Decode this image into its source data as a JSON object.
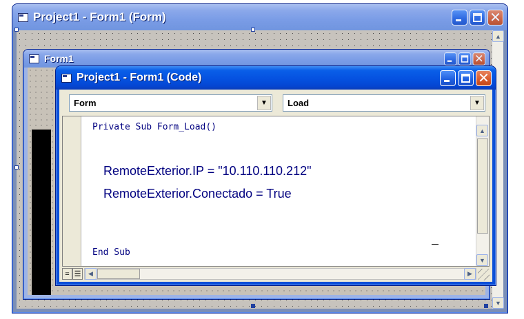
{
  "designer_window": {
    "title": "Project1 - Form1 (Form)",
    "icon": "form-designer-icon",
    "state": "inactive"
  },
  "form1_window": {
    "title": "Form1",
    "icon": "form-icon",
    "state": "inactive"
  },
  "code_window": {
    "title": "Project1 - Form1 (Code)",
    "icon": "code-window-icon",
    "state": "active",
    "object_combo": {
      "value": "Form"
    },
    "procedure_combo": {
      "value": "Load"
    },
    "code_lines": {
      "sub_start": "Private Sub Form_Load()",
      "ip_assign": "RemoteExterior.IP = \"10.110.110.212\"",
      "connect_assign": "RemoteExterior.Conectado = True",
      "sub_end": "End Sub"
    },
    "view_buttons": {
      "procedure_view": "=",
      "full_module_view": "☰"
    }
  },
  "caption_buttons": {
    "minimize": "minimize",
    "maximize": "maximize",
    "close": "✕"
  },
  "colors": {
    "xp_title_active": "#0551e0",
    "xp_title_inactive": "#7a9ce6",
    "code_text": "#000080",
    "close_button": "#d85a2c"
  }
}
